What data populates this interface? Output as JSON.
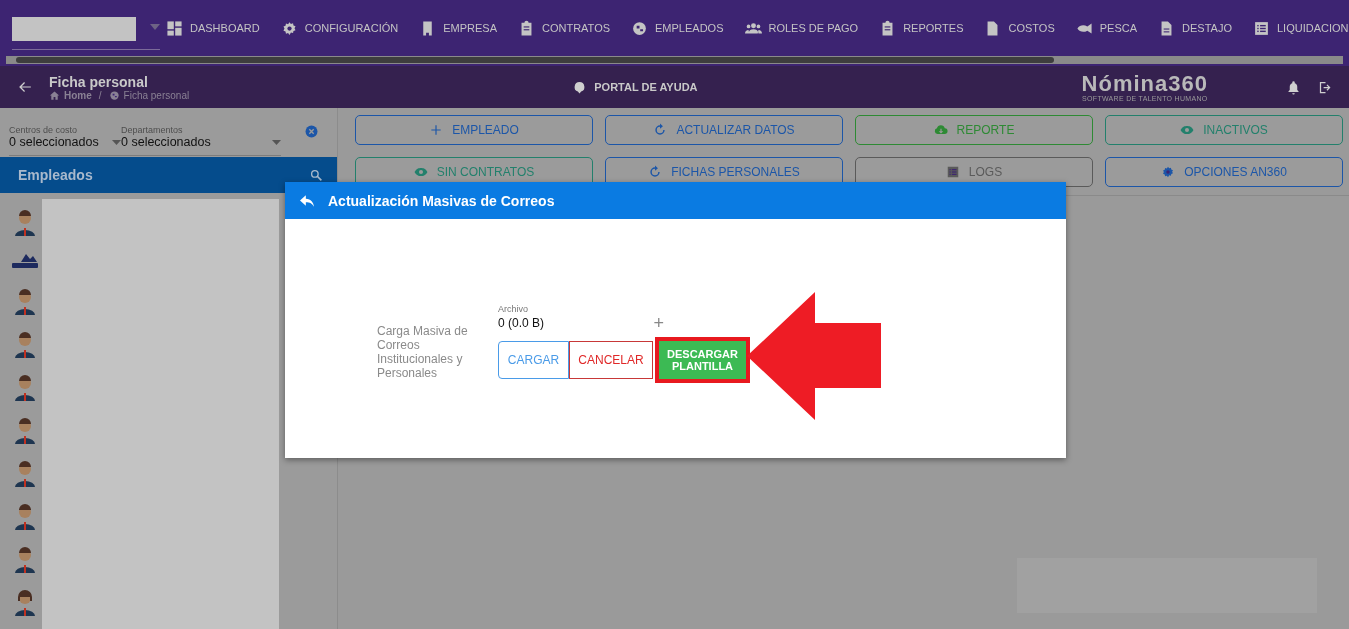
{
  "nav": {
    "items": [
      {
        "label": "DASHBOARD",
        "kind": "dashboard"
      },
      {
        "label": "CONFIGURACIÓN",
        "kind": "gear"
      },
      {
        "label": "EMPRESA",
        "kind": "building"
      },
      {
        "label": "CONTRATOS",
        "kind": "clipboard"
      },
      {
        "label": "EMPLEADOS",
        "kind": "globe"
      },
      {
        "label": "ROLES DE PAGO",
        "kind": "people"
      },
      {
        "label": "REPORTES",
        "kind": "clipboard"
      },
      {
        "label": "COSTOS",
        "kind": "dollar-doc"
      },
      {
        "label": "PESCA",
        "kind": "fish"
      },
      {
        "label": "DESTAJO",
        "kind": "doc"
      },
      {
        "label": "LIQUIDACION",
        "kind": "list"
      }
    ]
  },
  "header": {
    "title": "Ficha personal",
    "breadcrumb": [
      "Home",
      "Ficha personal"
    ],
    "separator": "/",
    "help": "PORTAL DE AYUDA",
    "logo": "Nómina360",
    "tagline": "SOFTWARE DE TALENTO HUMANO"
  },
  "filters": [
    {
      "label": "Centros de costo",
      "value": "0 seleccionados"
    },
    {
      "label": "Departamentos",
      "value": "0 seleccionados"
    }
  ],
  "employees": {
    "title": "Empleados",
    "avatars": [
      {
        "kind": "male"
      },
      {
        "kind": "company"
      },
      {
        "kind": "male"
      },
      {
        "kind": "male"
      },
      {
        "kind": "male"
      },
      {
        "kind": "male"
      },
      {
        "kind": "male"
      },
      {
        "kind": "male"
      },
      {
        "kind": "male"
      },
      {
        "kind": "female"
      }
    ]
  },
  "actions": [
    {
      "label": "EMPLEADO",
      "kind": "plus",
      "color": "#1c56a8"
    },
    {
      "label": "ACTUALIZAR DATOS",
      "kind": "refresh",
      "color": "#1c56a8"
    },
    {
      "label": "REPORTE",
      "kind": "cloud",
      "color": "#2e8a34"
    },
    {
      "label": "INACTIVOS",
      "kind": "eye",
      "color": "#23806c"
    },
    {
      "label": "SIN CONTRATOS",
      "kind": "eye",
      "color": "#23806c"
    },
    {
      "label": "FICHAS PERSONALES",
      "kind": "refresh",
      "color": "#1c56a8"
    },
    {
      "label": "LOGS",
      "kind": "list",
      "color": "#5a5a5a"
    },
    {
      "label": "OPCIONES AN360",
      "kind": "gear",
      "color": "#1c56a8"
    }
  ],
  "dialog": {
    "title": "Actualización Masivas de Correos",
    "field_label": "Carga Masiva de Correos Institucionales y Personales",
    "file_label": "Archivo",
    "file_value": "0 (0.0 B)",
    "add": "+",
    "buttons": [
      {
        "label": "CARGAR",
        "kind": "upload",
        "highlighted": false
      },
      {
        "label": "CANCELAR",
        "kind": "cancel",
        "highlighted": false
      },
      {
        "label": "DESCARGAR PLANTILLA",
        "kind": "download",
        "highlighted": true
      }
    ]
  }
}
